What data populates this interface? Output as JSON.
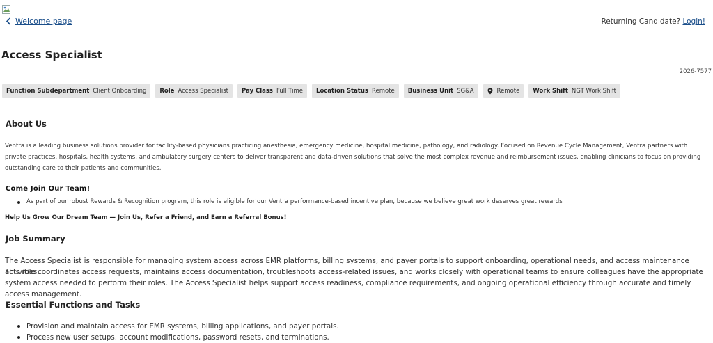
{
  "header": {
    "back_label": "Welcome page",
    "returning_label": "Returning Candidate?",
    "login_label": "Login!"
  },
  "job": {
    "title": "Access Specialist",
    "req_id": "2026-7577",
    "tags": [
      {
        "key": "Function Subdepartment",
        "value": "Client Onboarding"
      },
      {
        "key": "Role",
        "value": "Access Specialist"
      },
      {
        "key": "Pay Class",
        "value": "Full Time"
      },
      {
        "key": "Location Status",
        "value": "Remote"
      },
      {
        "key": "Business Unit",
        "value": "SG&A"
      },
      {
        "key": "",
        "value": "Remote",
        "icon": "map-pin-icon"
      },
      {
        "key": "Work Shift",
        "value": "NGT Work Shift"
      }
    ]
  },
  "about": {
    "heading": "About Us",
    "body": "Ventra is a leading business solutions provider for facility-based physicians practicing anesthesia, emergency medicine, hospital medicine, pathology, and radiology. Focused on Revenue Cycle Management, Ventra partners with private practices, hospitals, health systems, and ambulatory surgery centers to deliver transparent and data-driven solutions that solve the most complex revenue and reimbursement issues, enabling clinicians to focus on providing outstanding care to their patients and communities."
  },
  "join": {
    "heading": "Come Join Our Team!",
    "bullets": [
      "As part of our robust Rewards & Recognition program, this role is eligible for our Ventra performance-based incentive plan, because we believe great work deserves great rewards"
    ],
    "referral": "Help Us Grow Our Dream Team — Join Us, Refer a Friend, and Earn a Referral Bonus!"
  },
  "summary": {
    "heading": "Job Summary",
    "line1": "The Access Specialist is responsible for managing system access across EMR platforms, billing systems, and payer portals to support onboarding, operational needs, and access maintenance activities.",
    "line2": "This role coordinates access requests, maintains access documentation, troubleshoots access-related issues, and works closely with operational teams to ensure colleagues have the appropriate system access needed to perform their roles. The Access Specialist helps support access readiness, compliance requirements, and ongoing operational efficiency through accurate and timely access management."
  },
  "functions": {
    "heading": "Essential Functions and Tasks",
    "bullets": [
      "Provision and maintain access for EMR systems, billing applications, and payer portals.",
      "Process new user setups, account modifications, password resets, and terminations."
    ]
  }
}
